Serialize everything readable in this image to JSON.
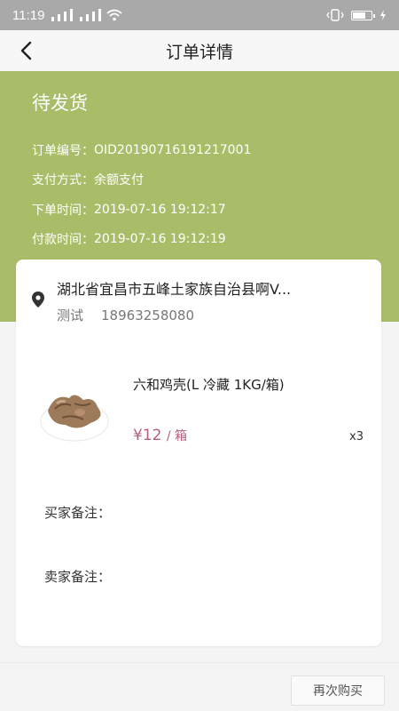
{
  "status_bar": {
    "time": "11:19"
  },
  "nav": {
    "title": "订单详情"
  },
  "order": {
    "status": "待发货",
    "fields": [
      {
        "label": "订单编号：",
        "value": "OID20190716191217001"
      },
      {
        "label": "支付方式：",
        "value": "余额支付"
      },
      {
        "label": "下单时间：",
        "value": "2019-07-16 19:12:17"
      },
      {
        "label": "付款时间：",
        "value": "2019-07-16 19:12:19"
      }
    ]
  },
  "address": {
    "line": "湖北省宜昌市五峰土家族自治县啊V...",
    "name": "测试",
    "phone": "18963258080"
  },
  "product": {
    "name": "六和鸡壳(L 冷藏 1KG/箱)",
    "price": "¥12",
    "unit": "/ 箱",
    "quantity": "x3"
  },
  "remarks": {
    "buyer_label": "买家备注：",
    "seller_label": "卖家备注："
  },
  "actions": {
    "rebuy": "再次购买"
  },
  "colors": {
    "header_bg": "#a9bd68",
    "price": "#b85b7c",
    "status_bar": "#a9a9a9"
  },
  "icons": {
    "back": "chevron-left-icon",
    "location": "location-pin-icon"
  }
}
